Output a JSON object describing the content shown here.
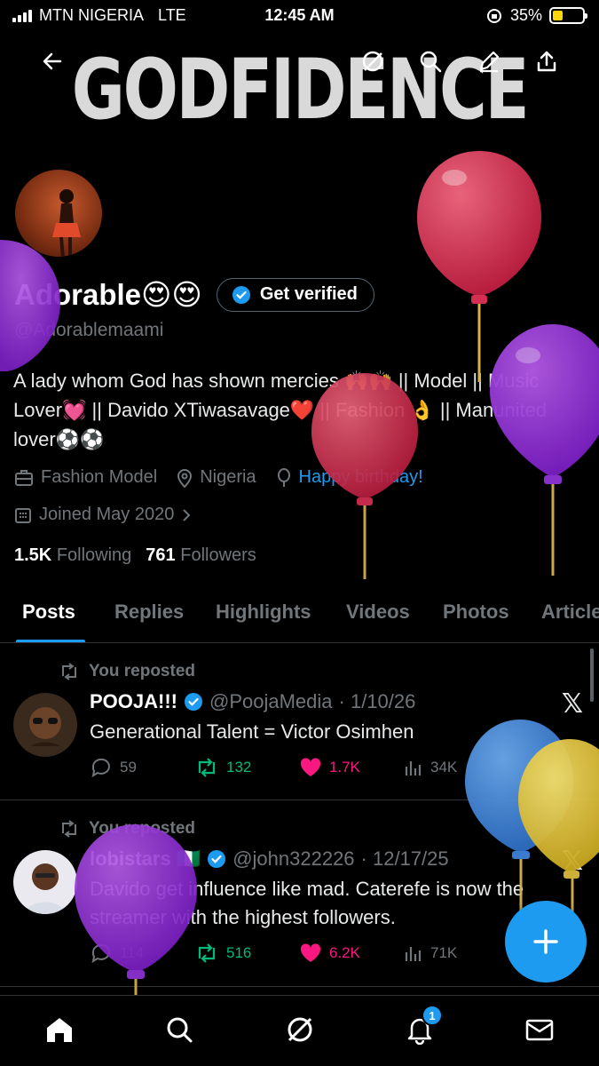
{
  "status_bar": {
    "carrier": "MTN NIGERIA",
    "network": "LTE",
    "time": "12:45 AM",
    "battery_percent": "35%",
    "battery_level": 0.35
  },
  "header": {
    "banner_text": "GODFIDENCE",
    "back_icon": "arrow-left-icon",
    "grok_icon": "grok-icon",
    "search_icon": "search-icon",
    "edit_icon": "pencil-icon",
    "share_icon": "share-icon"
  },
  "profile": {
    "name": "Adorable",
    "name_emoji": "😍😍",
    "get_verified_label": "Get verified",
    "handle": "@Adorablemaami",
    "bio": "A lady whom God has shown mercies 🙌🙌 || Model || Music Lover💓 || Davido XTiwasavage❤️ || Fashion 👌 || Manunited lover⚽⚽",
    "category": "Fashion Model",
    "location": "Nigeria",
    "birthday": "Happy birthday!",
    "joined": "Joined May 2020",
    "following_count": "1.5K",
    "following_label": "Following",
    "followers_count": "761",
    "followers_label": "Followers"
  },
  "tabs": [
    "Posts",
    "Replies",
    "Highlights",
    "Videos",
    "Photos",
    "Articles"
  ],
  "active_tab": "Posts",
  "posts": [
    {
      "repost_label": "You reposted",
      "name": "POOJA!!!",
      "handle": "@PoojaMedia",
      "date": "· 1/10/26",
      "text": "Generational Talent = Victor Osimhen",
      "replies": "59",
      "reposts": "132",
      "likes": "1.7K",
      "views": "34K"
    },
    {
      "repost_label": "You reposted",
      "name": "lobistars 🇳🇬",
      "handle": "@john322226",
      "date": "· 12/17/25",
      "text": "Davido get influence like mad. Caterefe is now the streamer with the highest followers.",
      "replies": "114",
      "reposts": "516",
      "likes": "6.2K",
      "views": "71K"
    }
  ],
  "notification_count": "1",
  "colors": {
    "accent": "#1d9bf0",
    "repost": "#00ba7c",
    "like": "#f91880",
    "muted": "#71767b",
    "battery": "#ffd60a"
  }
}
